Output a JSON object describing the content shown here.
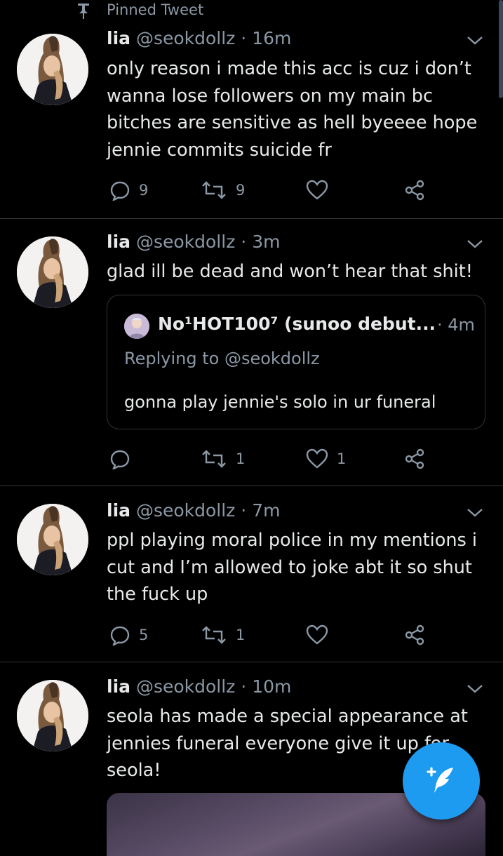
{
  "pinned": {
    "label": "Pinned Tweet"
  },
  "tweets": [
    {
      "name": "lia",
      "handle": "@seokdollz",
      "sep": "·",
      "time": "16m",
      "lines": [
        "only reason i made this acc is cuz i don’t",
        "wanna lose followers on my main bc",
        "bitches are sensitive as hell byeeee hope",
        "jennie commits suicide fr"
      ],
      "replies": "9",
      "retweets": "9",
      "likes": ""
    },
    {
      "name": "lia",
      "handle": "@seokdollz",
      "sep": "·",
      "time": "3m",
      "lines": [
        "glad ill be dead and won’t hear that shit!"
      ],
      "replies": "",
      "retweets": "1",
      "likes": "1",
      "quote": {
        "name": "No¹HOT100⁷ (sunoo debut...",
        "sep_time": "· 4m",
        "replying_prefix": "Replying to ",
        "replying_handle": "@seokdollz",
        "text": "gonna play jennie's solo in ur funeral"
      }
    },
    {
      "name": "lia",
      "handle": "@seokdollz",
      "sep": "·",
      "time": "7m",
      "lines": [
        "ppl playing moral police in my mentions i",
        "cut and I’m allowed to joke abt it so shut",
        "the fuck up"
      ],
      "replies": "5",
      "retweets": "1",
      "likes": ""
    },
    {
      "name": "lia",
      "handle": "@seokdollz",
      "sep": "·",
      "time": "10m",
      "lines": [
        "seola has made a special appearance at",
        "jennies funeral everyone give it up for",
        "seola!"
      ]
    }
  ],
  "icons": {
    "pin": "pin-icon",
    "reply": "reply-icon",
    "retweet": "retweet-icon",
    "like": "heart-icon",
    "share": "share-icon",
    "more": "chevron-down-icon",
    "compose": "compose-tweet-icon"
  },
  "colors": {
    "accent": "#1d9bf0",
    "background": "#000000",
    "muted": "#8b98a5",
    "text": "#e7e9ea"
  }
}
